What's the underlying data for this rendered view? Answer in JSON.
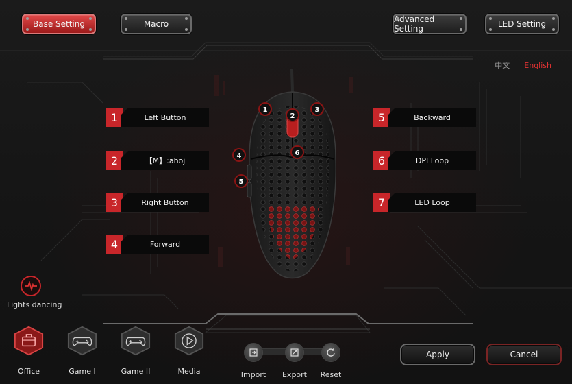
{
  "nav": {
    "base_setting": "Base Setting",
    "macro": "Macro",
    "advanced_setting": "Advanced Setting",
    "led_setting": "LED Setting"
  },
  "language": {
    "chinese": "中文",
    "english": "English",
    "selected": "English"
  },
  "buttons_left": [
    {
      "num": "1",
      "label": "Left Button"
    },
    {
      "num": "2",
      "label": "【M】:ahoj"
    },
    {
      "num": "3",
      "label": "Right Button"
    },
    {
      "num": "4",
      "label": "Forward"
    }
  ],
  "buttons_right": [
    {
      "num": "5",
      "label": "Backward"
    },
    {
      "num": "6",
      "label": "DPI Loop"
    },
    {
      "num": "7",
      "label": "LED Loop"
    }
  ],
  "mouse_markers": [
    "1",
    "2",
    "3",
    "4",
    "5",
    "6"
  ],
  "lights": {
    "label": "Lights dancing",
    "icon": "pulse-icon"
  },
  "profiles": [
    {
      "label": "Office",
      "icon": "briefcase-icon",
      "active": true
    },
    {
      "label": "Game I",
      "icon": "gamepad-icon",
      "active": false
    },
    {
      "label": "Game II",
      "icon": "gamepad-icon",
      "active": false
    },
    {
      "label": "Media",
      "icon": "play-icon",
      "active": false
    }
  ],
  "file_actions": {
    "import": "Import",
    "export": "Export",
    "reset": "Reset"
  },
  "actions": {
    "apply": "Apply",
    "cancel": "Cancel"
  },
  "colors": {
    "accent": "#c8262a",
    "background": "#161616",
    "label_bg": "#0a0a0a"
  }
}
